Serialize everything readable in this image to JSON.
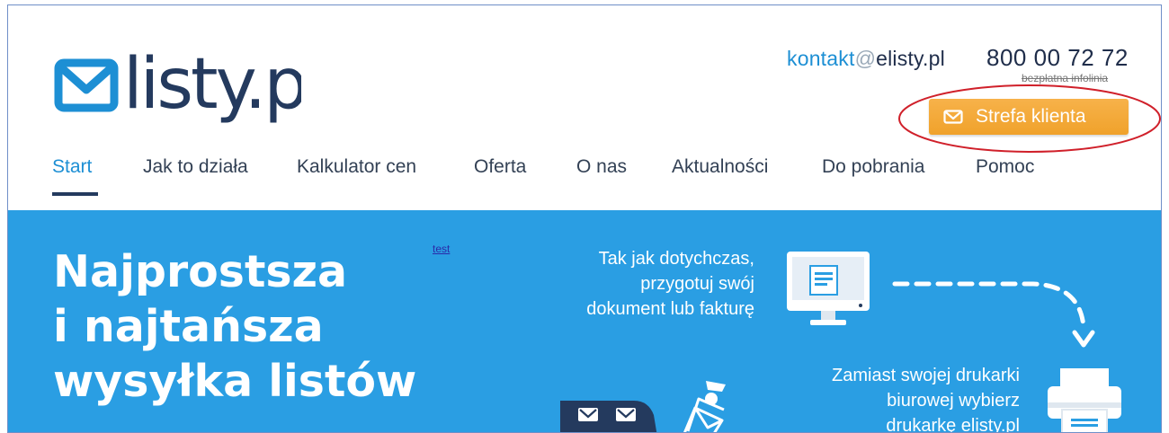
{
  "brand": {
    "logo_text": "listy.pl",
    "logo_prefix": "e"
  },
  "header": {
    "contact_part1": "kontakt",
    "contact_at": "@",
    "contact_part2": "elisty.pl",
    "phone": "800 00 72 72",
    "phone_sub": "bezpłatna infolinia",
    "client_zone_label": "Strefa klienta"
  },
  "nav": {
    "items": [
      {
        "label": "Start",
        "active": true
      },
      {
        "label": "Jak to działa"
      },
      {
        "label": "Kalkulator cen"
      },
      {
        "label": "Oferta"
      },
      {
        "label": "O nas"
      },
      {
        "label": "Aktualności"
      },
      {
        "label": "Do pobrania"
      },
      {
        "label": "Pomoc"
      }
    ]
  },
  "hero": {
    "title_lines": [
      "Najprostsza",
      "i najtańsza",
      "wysyłka listów"
    ],
    "test_link": "test",
    "step1_lines": [
      "Tak jak dotychczas,",
      "przygotuj swój",
      "dokument lub fakturę"
    ],
    "step2_lines": [
      "Zamiast swojej drukarki",
      "biurowej wybierz",
      "drukarkę elisty.pl"
    ]
  },
  "colors": {
    "brand_blue": "#1d8fd4",
    "navy": "#243a5e",
    "hero_bg": "#2a9ee3",
    "button_orange": "#f0a22b",
    "annotation_red": "#d0202a"
  },
  "icons": {
    "logo": "envelope-logo-icon",
    "button": "mail-icon",
    "monitor": "monitor-icon",
    "printer": "printer-icon",
    "arrow": "arrow-down-icon",
    "truck": "delivery-truck-icon",
    "letters": "letter-stack-icon"
  }
}
